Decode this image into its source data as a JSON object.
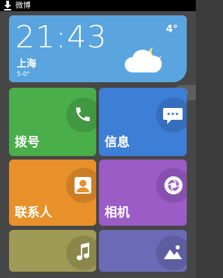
{
  "status_bar": {
    "notification_text": "微博",
    "download_icon": "download-arrow-icon"
  },
  "weather": {
    "time": "21:43",
    "city": "上海",
    "range": "5-0°",
    "temp": "4°",
    "icon": "moon-cloud-icon"
  },
  "tiles": {
    "dial": {
      "label": "拨号",
      "icon": "phone-icon",
      "color": "#4aae4a"
    },
    "messages": {
      "label": "信息",
      "icon": "chat-bubble-icon",
      "color": "#3d7ed6"
    },
    "contacts": {
      "label": "联系人",
      "icon": "person-icon",
      "color": "#e8902a"
    },
    "camera": {
      "label": "相机",
      "icon": "camera-shutter-icon",
      "color": "#9b5cc6"
    },
    "music": {
      "label": "",
      "icon": "music-note-icon",
      "color": "#9f9a55"
    },
    "gallery": {
      "label": "",
      "icon": "mountain-picture-icon",
      "color": "#6c6ab7"
    }
  },
  "colors": {
    "status_bar": "#000000",
    "background": "#474747",
    "weather_tile": "#5aa5df"
  }
}
